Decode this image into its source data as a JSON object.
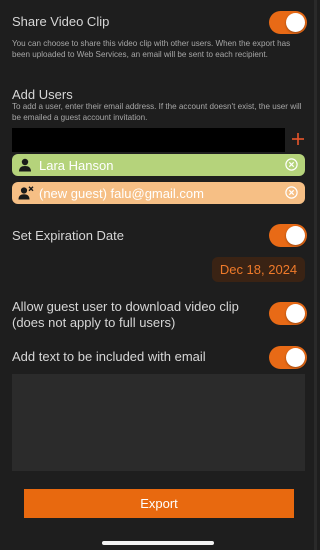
{
  "share": {
    "title": "Share Video Clip",
    "help": "You can choose to share this video clip with other users. When the export has been uploaded to Web Services, an email will be sent to each recipient.",
    "enabled": true
  },
  "add_users": {
    "title": "Add Users",
    "help": "To add a user, enter their email address.  If the account doesn't exist, the user will be emailed a guest account invitation.",
    "email_value": "",
    "add_icon": "plus-icon",
    "users": [
      {
        "label": "Lara Hanson",
        "type": "full",
        "icon": "person-icon",
        "color": "#b5d37b"
      },
      {
        "label": "(new guest) falu@gmail.com",
        "type": "guest",
        "icon": "person-x-icon",
        "color": "#f6bf85"
      }
    ]
  },
  "expiration": {
    "title": "Set Expiration Date",
    "enabled": true,
    "date": "Dec 18, 2024"
  },
  "guest_download": {
    "title": "Allow guest user to download video clip (does not apply to full users)",
    "enabled": true
  },
  "email_text": {
    "title": "Add text to be included with email",
    "enabled": true,
    "value": ""
  },
  "export": {
    "label": "Export"
  },
  "colors": {
    "accent": "#e8690f",
    "background": "#1e1e1e"
  }
}
